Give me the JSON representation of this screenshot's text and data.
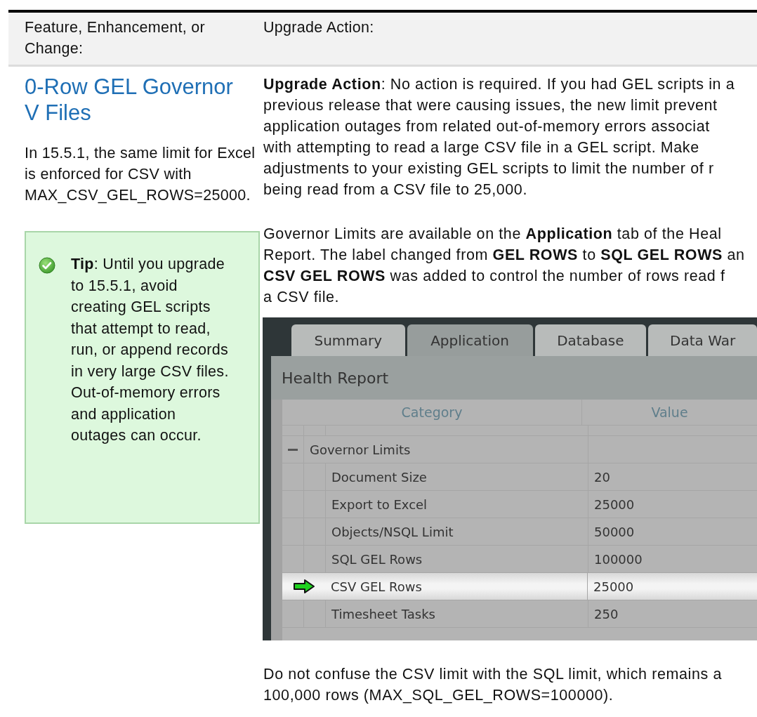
{
  "table": {
    "columns": [
      "Feature, Enhancement, or Change:",
      "Upgrade Action:"
    ],
    "row": {
      "heading_lines": [
        "0-Row GEL Governor",
        "V Files"
      ],
      "description": "In 15.5.1, the same limit for Excel is enforced for CSV with MAX_CSV_GEL_ROWS=25000.",
      "tip": "**Tip**: Until you upgrade to 15.5.1, avoid creating GEL scripts that attempt to read, run, or append records in very large CSV files. Out-of-memory errors and application outages can occur.",
      "action_paragraphs": [
        {
          "lines": [
            "**Upgrade Action**: No action is required. If you had GEL scripts in a",
            "previous release that were causing issues, the new limit prevent",
            "application outages from related out-of-memory errors associat",
            "with attempting to read a large CSV file in a GEL script. Make",
            "adjustments to your existing GEL scripts to limit the number of r",
            "being read from a CSV file to 25,000."
          ]
        },
        {
          "lines": [
            "Governor Limits are available on the **Application** tab of the Heal",
            "Report. The label changed from **GEL ROWS** to **SQL GEL ROWS** an",
            "**CSV GEL ROWS** was added to control the number of rows read f",
            "a CSV file."
          ]
        }
      ],
      "screenshot": {
        "tabs": [
          {
            "label": "Summary",
            "selected": false
          },
          {
            "label": "Application",
            "selected": true
          },
          {
            "label": "Database",
            "selected": false
          },
          {
            "label": "Data War",
            "selected": false
          }
        ],
        "panel_title": "Health Report",
        "grid_columns": [
          "Category",
          "Value"
        ],
        "tree": [
          {
            "label": "Governor Limits",
            "expanded": true,
            "children": [
              {
                "label": "Document Size",
                "value": "20",
                "highlighted": false
              },
              {
                "label": "Export to Excel",
                "value": "25000",
                "highlighted": false
              },
              {
                "label": "Objects/NSQL Limit",
                "value": "50000",
                "highlighted": false
              },
              {
                "label": "SQL GEL Rows",
                "value": "100000",
                "highlighted": false
              },
              {
                "label": "CSV GEL Rows",
                "value": "25000",
                "highlighted": true
              },
              {
                "label": "Timesheet Tasks",
                "value": "250",
                "highlighted": false
              }
            ]
          }
        ]
      },
      "closing_lines": [
        "Do not confuse the CSV limit with the SQL limit, which remains a",
        "100,000 rows (MAX_SQL_GEL_ROWS=100000)."
      ]
    }
  }
}
